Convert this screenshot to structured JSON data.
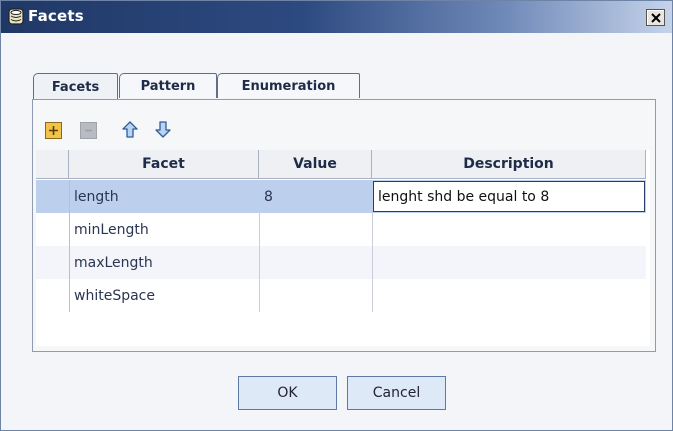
{
  "window": {
    "title": "Facets",
    "title_icon": "database-icon",
    "close_icon": "close-icon"
  },
  "tabs": [
    {
      "label": "Facets",
      "active": true
    },
    {
      "label": "Pattern",
      "active": false
    },
    {
      "label": "Enumeration",
      "active": false
    }
  ],
  "toolbar": {
    "add_icon": "plus-icon",
    "remove_icon": "minus-icon",
    "up_icon": "arrow-up-icon",
    "down_icon": "arrow-down-icon"
  },
  "table": {
    "columns": [
      "Facet",
      "Value",
      "Description"
    ],
    "rows": [
      {
        "facet": "length",
        "value": "8",
        "description": "lenght shd be equal to 8",
        "selected": true
      },
      {
        "facet": "minLength",
        "value": "",
        "description": "",
        "selected": false
      },
      {
        "facet": "maxLength",
        "value": "",
        "description": "",
        "selected": false
      },
      {
        "facet": "whiteSpace",
        "value": "",
        "description": "",
        "selected": false
      }
    ]
  },
  "buttons": {
    "ok": "OK",
    "cancel": "Cancel"
  },
  "colors": {
    "titlebar": "#203866",
    "selection": "#bcd0ee",
    "accent_button": "#dee9f7"
  }
}
